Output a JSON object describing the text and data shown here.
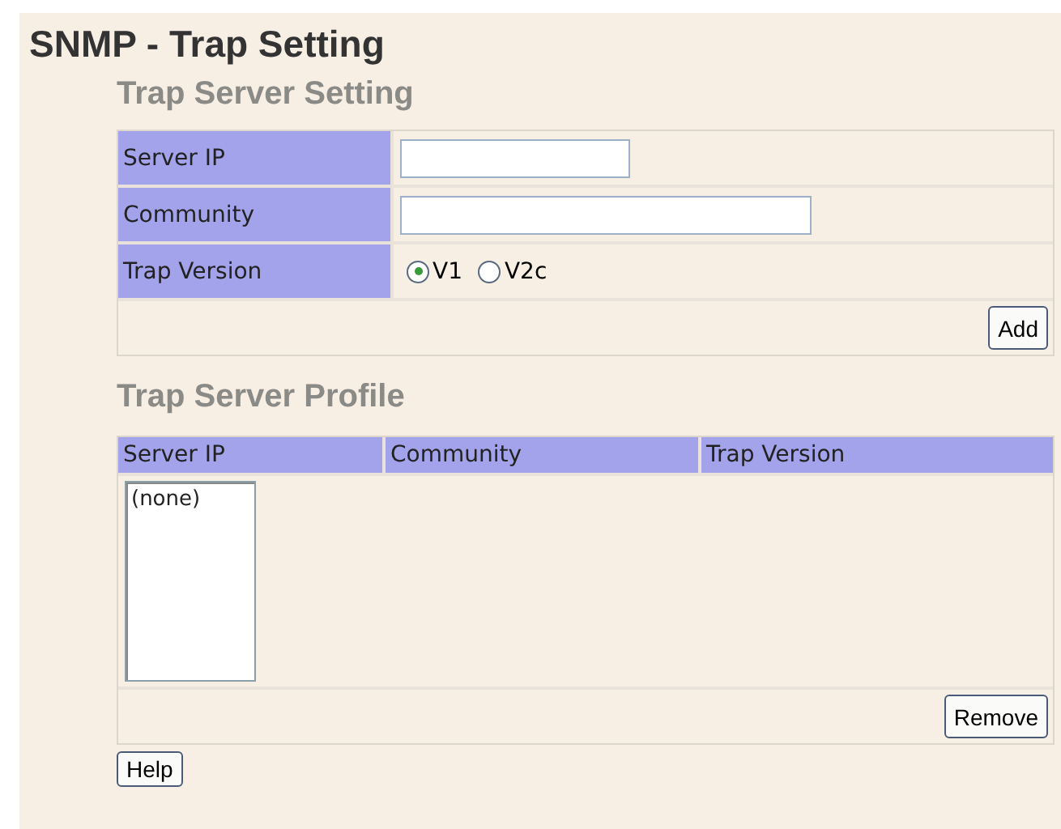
{
  "title": "SNMP - Trap Setting",
  "setting": {
    "heading": "Trap Server Setting",
    "fields": [
      {
        "kind": "text",
        "label": "Server IP",
        "wide": false
      },
      {
        "kind": "text",
        "label": "Community",
        "wide": true
      },
      {
        "kind": "radio",
        "label": "Trap Version",
        "options": [
          {
            "label": "V1",
            "selected": true
          },
          {
            "label": "V2c",
            "selected": false
          }
        ]
      }
    ],
    "button": "Add"
  },
  "profile": {
    "heading": "Trap Server Profile",
    "columns": [
      "Server IP",
      "Community",
      "Trap Version"
    ],
    "list_items": [
      "(none)"
    ],
    "button": "Remove"
  },
  "help_button": "Help"
}
